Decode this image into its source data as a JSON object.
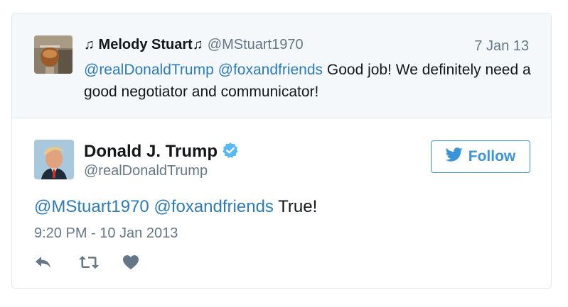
{
  "quoted_tweet": {
    "name": "♫ Melody Stuart♫",
    "handle": "@MStuart1970",
    "date": "7 Jan 13",
    "mention_1": "@realDonaldTrump",
    "mention_2": "@foxandfriends",
    "text": "Good job! We definitely need a good negotiator and communicator!"
  },
  "main_tweet": {
    "name": "Donald J. Trump",
    "handle": "@realDonaldTrump",
    "follow_label": "Follow",
    "mention_1": "@MStuart1970",
    "mention_2": "@foxandfriends",
    "text": "True!",
    "timestamp": "9:20 PM - 10 Jan 2013"
  },
  "colors": {
    "link": "#2b7bb9",
    "follow": "#3b94d9",
    "verified": "#1da1f2",
    "muted": "#657786",
    "action_icon": "#657786"
  },
  "icons": {
    "verified": "verified-badge-icon",
    "follow": "twitter-bird-icon",
    "reply": "reply-icon",
    "retweet": "retweet-icon",
    "like": "heart-icon"
  }
}
